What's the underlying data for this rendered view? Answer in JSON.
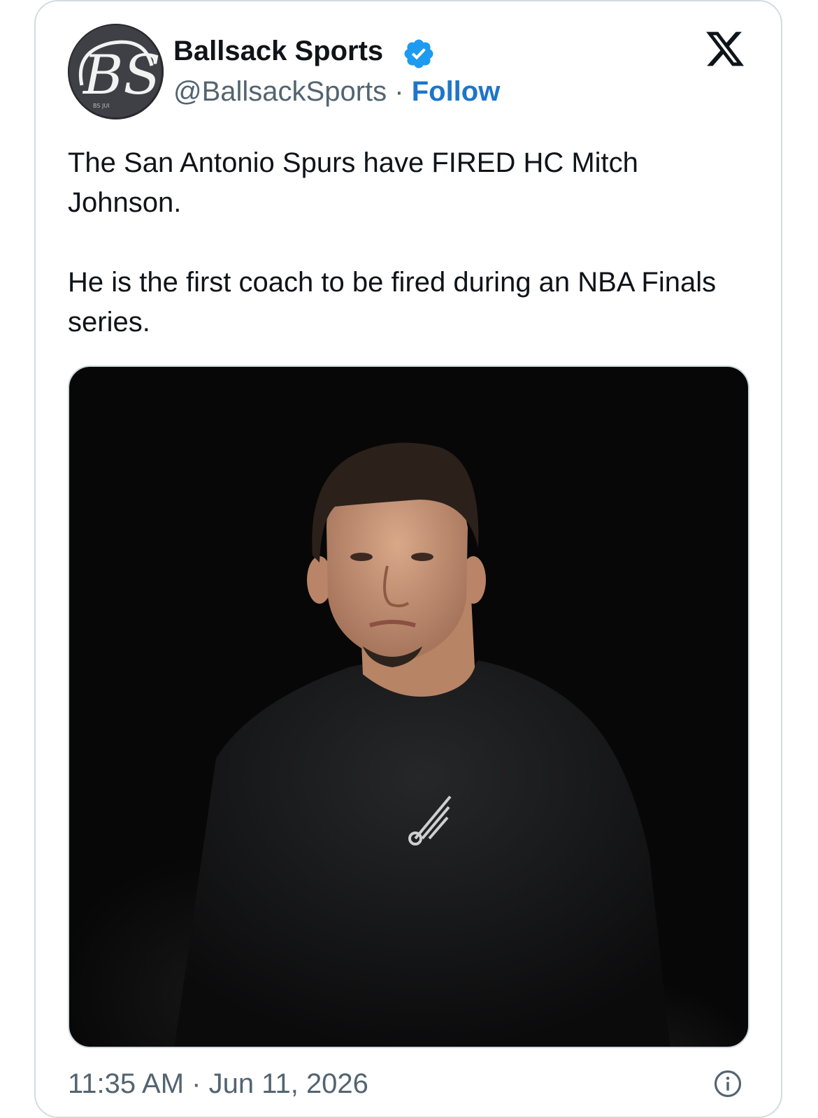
{
  "author": {
    "name": "Ballsack Sports",
    "handle": "@BallsackSports",
    "separator": " · ",
    "follow_label": "Follow",
    "avatar_initials": "BS",
    "verified_icon": "verified-badge-icon"
  },
  "tweet": {
    "paragraphs": [
      "The San Antonio Spurs have FIRED HC Mitch Johnson.",
      "He is the first coach to be fired during an NBA Finals series."
    ],
    "photo_icon": "coach-photo"
  },
  "footer": {
    "timestamp": "11:35 AM · Jun 11, 2026",
    "info_icon": "info-icon"
  },
  "colors": {
    "text": "#0f1419",
    "secondary": "#536471",
    "follow": "#1d76c9",
    "verified": "#1d9bf0",
    "border": "#d3dce3"
  }
}
